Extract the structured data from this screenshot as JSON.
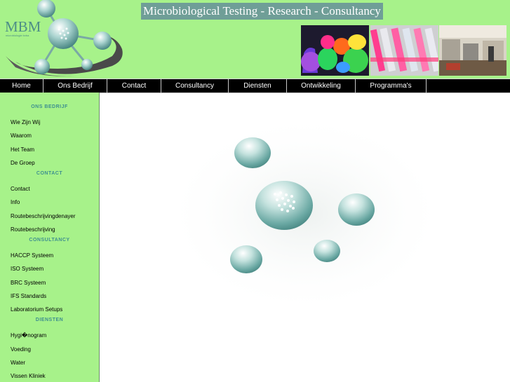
{
  "header": {
    "logo_text": "MBM",
    "logo_subtext": "microbiologie bvba",
    "banner_title": "Microbiological Testing - Research - Consultancy",
    "photos": [
      {
        "name": "colored-flasks-photo"
      },
      {
        "name": "test-tubes-photo"
      },
      {
        "name": "laboratory-photo"
      }
    ]
  },
  "nav": {
    "items": [
      {
        "label": "Home"
      },
      {
        "label": "Ons Bedrijf"
      },
      {
        "label": "Contact"
      },
      {
        "label": "Consultancy"
      },
      {
        "label": "Diensten"
      },
      {
        "label": "Ontwikkeling"
      },
      {
        "label": "Programma's"
      }
    ]
  },
  "sidebar": {
    "sections": [
      {
        "heading": "ONS BEDRIJF",
        "links": [
          "Wie Zijn Wij",
          "Waarom",
          "Het Team",
          "De Groep"
        ]
      },
      {
        "heading": "CONTACT",
        "links": [
          "Contact",
          "Info",
          "Routebeschrijvingdenayer",
          "Routebeschrijving"
        ]
      },
      {
        "heading": "CONSULTANCY",
        "links": [
          "HACCP Systeem",
          "ISO Systeem",
          "BRC Systeem",
          "IFS Standards",
          "Laboratorium Setups"
        ]
      },
      {
        "heading": "DIENSTEN",
        "links": [
          "Hygi�nogram",
          "Voeding",
          "Water",
          "Vissen Kliniek"
        ]
      }
    ]
  },
  "colors": {
    "background_green": "#a7f28a",
    "nav_black": "#000000",
    "heading_teal": "#3e8f8f",
    "banner_teal": "#6f9e97",
    "sphere_teal": "#5f9f9b"
  }
}
